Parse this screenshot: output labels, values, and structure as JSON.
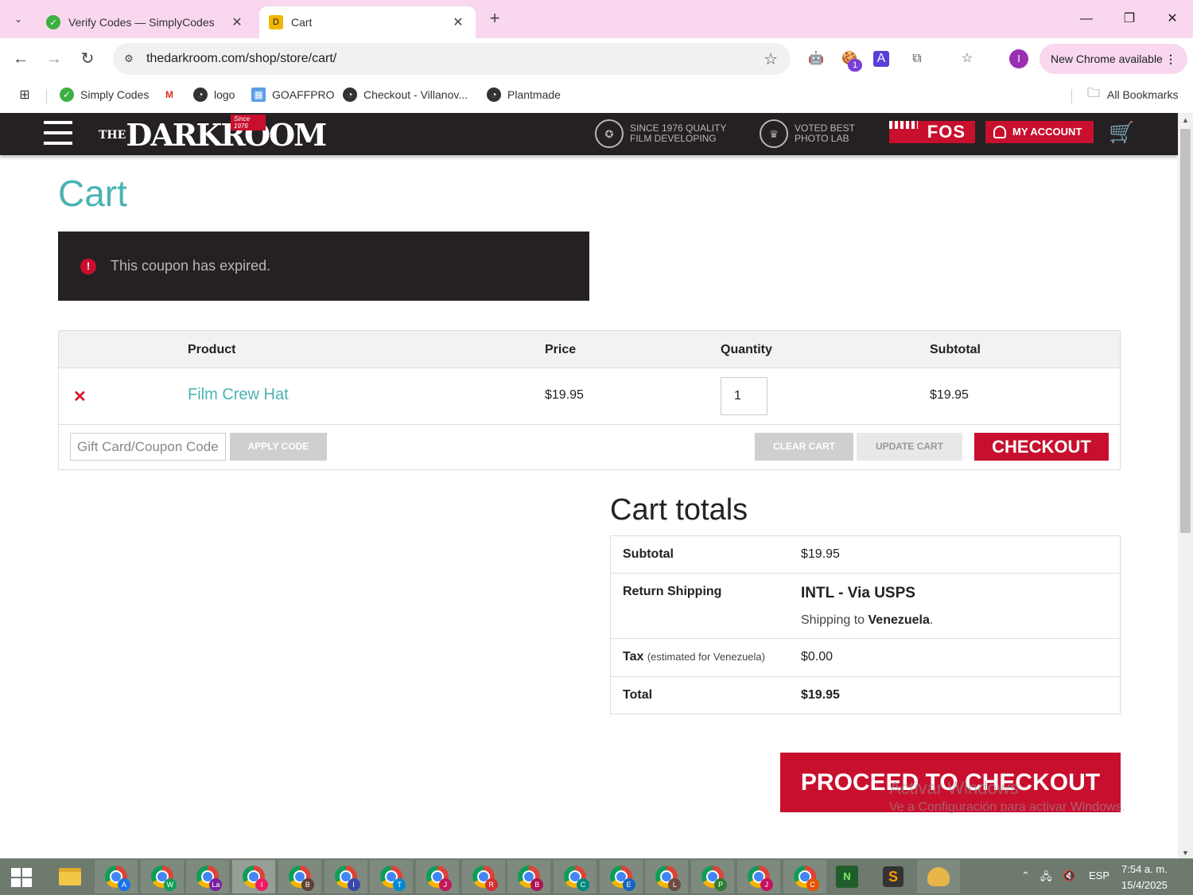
{
  "browser": {
    "tabs": [
      {
        "title": "Verify Codes — SimplyCodes",
        "active": false
      },
      {
        "title": "Cart",
        "active": true
      }
    ],
    "url": "thedarkroom.com/shop/store/cart/",
    "update_label": "New Chrome available",
    "extension_badge": "1",
    "profile_initial": "I",
    "bookmarks": [
      "Simply Codes",
      "logo",
      "GOAFFPRO",
      "Checkout - Villanov...",
      "Plantmade"
    ],
    "all_bookmarks": "All Bookmarks"
  },
  "site": {
    "logo_text": "DARKROOM",
    "logo_the": "THE",
    "logo_since": "Since 1976",
    "badge_quality": [
      "SINCE 1976 QUALITY",
      "FILM DEVELOPING"
    ],
    "badge_voted": [
      "VOTED BEST",
      "PHOTO LAB"
    ],
    "fos_label": "FOS",
    "account_label": "MY ACCOUNT"
  },
  "page": {
    "title": "Cart",
    "notice": "This coupon has expired."
  },
  "cart": {
    "headers": {
      "product": "Product",
      "price": "Price",
      "quantity": "Quantity",
      "subtotal": "Subtotal"
    },
    "items": [
      {
        "name": "Film Crew Hat",
        "price": "$19.95",
        "quantity": "1",
        "subtotal": "$19.95"
      }
    ],
    "coupon_placeholder": "Gift Card/Coupon Code",
    "apply_label": "APPLY CODE",
    "clear_label": "CLEAR CART",
    "update_label": "UPDATE CART",
    "checkout_label": "CHECKOUT"
  },
  "totals": {
    "title": "Cart totals",
    "subtotal_label": "Subtotal",
    "subtotal": "$19.95",
    "shipping_label": "Return Shipping",
    "shipping_method": "INTL - Via USPS",
    "shipping_to_prefix": "Shipping to",
    "shipping_country": "Venezuela",
    "tax_label": "Tax",
    "tax_note": "(estimated for Venezuela)",
    "tax": "$0.00",
    "total_label": "Total",
    "total": "$19.95",
    "proceed_label": "PROCEED TO CHECKOUT"
  },
  "watermark": {
    "line1": "Activar Windows",
    "line2": "Ve a Configuración para activar Windows."
  },
  "taskbar": {
    "chrome_profiles": [
      "A",
      "W",
      "La",
      "I",
      "B",
      "I",
      "T",
      "J",
      "R",
      "B",
      "C",
      "E",
      "L",
      "P",
      "J",
      "C"
    ],
    "language": "ESP",
    "time": "7:54 a. m.",
    "date": "15/4/2025"
  },
  "colors": {
    "accent_red": "#c8102e",
    "teal": "#4ab3b3",
    "header_dark": "#252122",
    "tab_strip": "#f8d7ef"
  }
}
